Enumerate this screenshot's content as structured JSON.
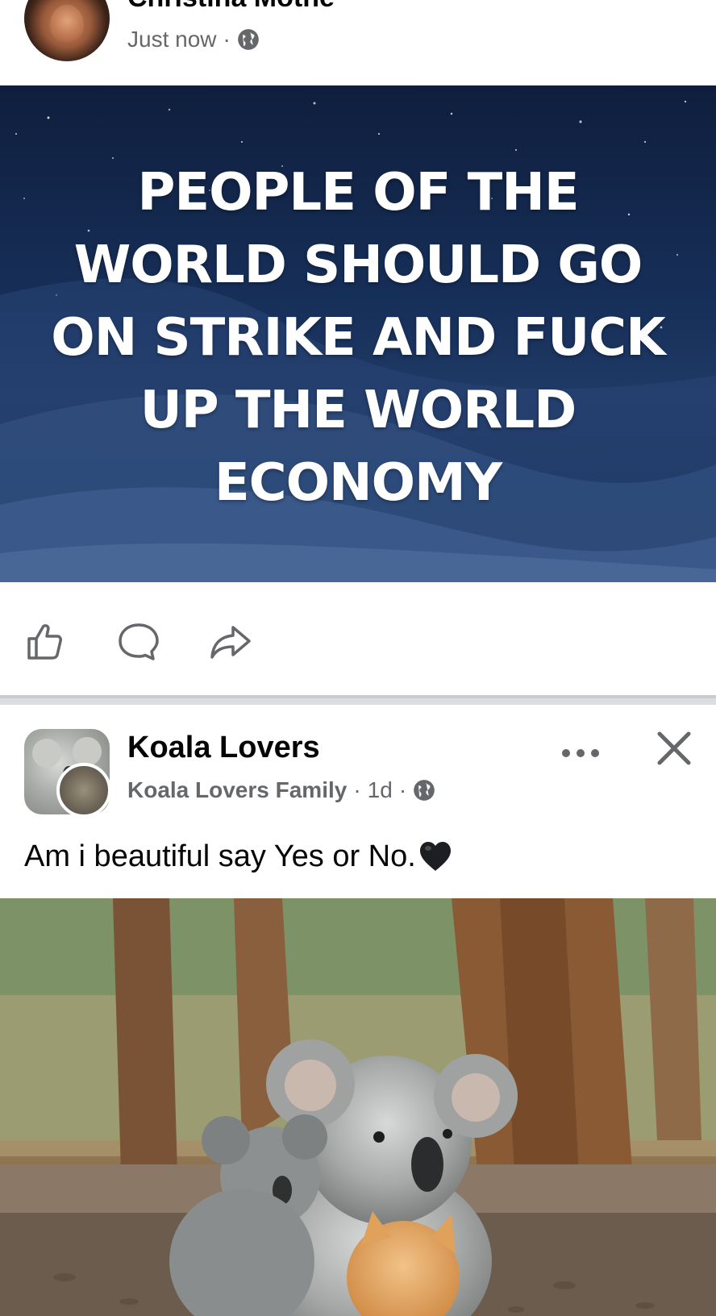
{
  "post1": {
    "author_name": "Christina Mothe",
    "timestamp": "Just now",
    "separator": "·",
    "privacy_icon": "globe-icon",
    "image_caption": "PEOPLE OF THE WORLD SHOULD GO ON STRIKE AND FUCK UP THE WORLD ECONOMY",
    "actions": [
      "like-icon",
      "comment-icon",
      "share-icon"
    ]
  },
  "post2": {
    "title": "Koala Lovers",
    "group_name": "Koala Lovers Family",
    "separator": "·",
    "timestamp": "1d",
    "privacy_icon": "globe-icon",
    "text": "Am i beautiful say Yes or No.",
    "emoji": "black-heart-emoji",
    "menu_icons": [
      "more-options-icon",
      "close-icon"
    ]
  },
  "colors": {
    "text_primary": "#050505",
    "text_secondary": "#65676b",
    "divider": "#dadde1",
    "caption_bg": "#17305a"
  }
}
